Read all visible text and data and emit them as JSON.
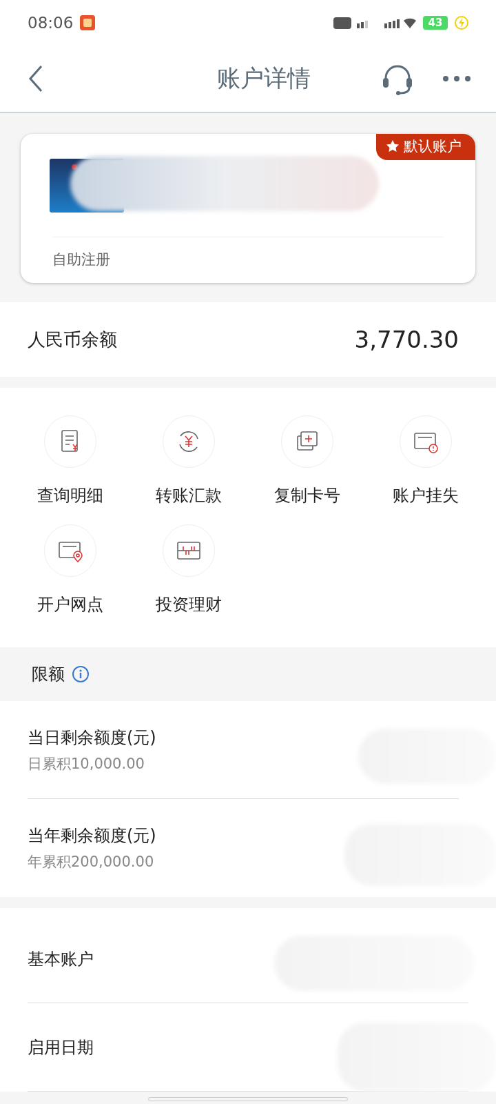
{
  "status_bar": {
    "time": "08:06",
    "battery": "43"
  },
  "header": {
    "title": "账户详情"
  },
  "card": {
    "badge": "默认账户",
    "registration": "自助注册"
  },
  "balance": {
    "label": "人民币余额",
    "amount": "3,770.30"
  },
  "actions": [
    {
      "label": "查询明细",
      "kind": "statement"
    },
    {
      "label": "转账汇款",
      "kind": "transfer"
    },
    {
      "label": "复制卡号",
      "kind": "copy"
    },
    {
      "label": "账户挂失",
      "kind": "loss"
    },
    {
      "label": "开户网点",
      "kind": "branch"
    },
    {
      "label": "投资理财",
      "kind": "invest"
    }
  ],
  "limits": {
    "title": "限额",
    "rows": [
      {
        "label": "当日剩余额度(元)",
        "sub": "日累积10,000.00"
      },
      {
        "label": "当年剩余额度(元)",
        "sub": "年累积200,000.00"
      }
    ]
  },
  "details": [
    {
      "label": "基本账户"
    },
    {
      "label": "启用日期"
    }
  ]
}
